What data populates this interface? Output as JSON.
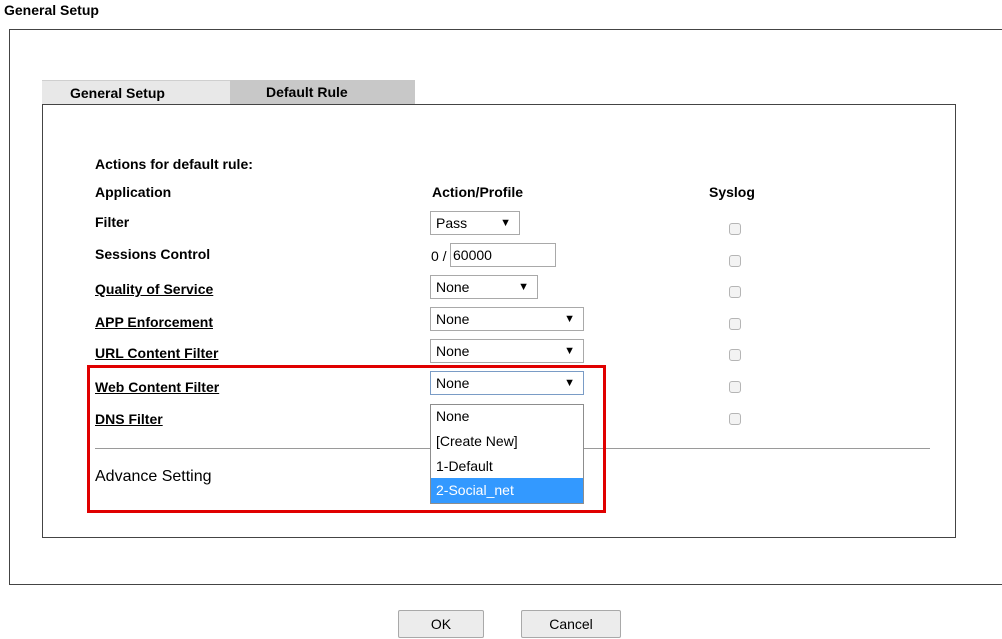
{
  "page": {
    "title": "General Setup"
  },
  "tabs": [
    {
      "label": "General Setup"
    },
    {
      "label": "Default Rule"
    }
  ],
  "section": {
    "heading": "Actions for default rule:",
    "columns": {
      "application": "Application",
      "action": "Action/Profile",
      "syslog": "Syslog"
    }
  },
  "rows": [
    {
      "label": "Filter",
      "value": "Pass",
      "underlined": false
    },
    {
      "label": "Sessions Control",
      "sessions_current": "0 /",
      "sessions_max": "60000",
      "underlined": false
    },
    {
      "label": "Quality of Service",
      "value": "None",
      "underlined": true
    },
    {
      "label": "APP Enforcement",
      "value": "None",
      "underlined": true
    },
    {
      "label": "URL Content Filter",
      "value": "None",
      "underlined": true
    },
    {
      "label": "Web Content Filter",
      "value": "None",
      "underlined": true
    },
    {
      "label": "DNS Filter",
      "underlined": true
    }
  ],
  "dropdown": {
    "options": [
      "None",
      "[Create New]",
      "1-Default",
      "2-Social_net"
    ],
    "highlighted_index": 3,
    "highlight_color": "#3399ff"
  },
  "advance": {
    "label": "Advance Setting"
  },
  "buttons": {
    "ok": "OK",
    "cancel": "Cancel"
  },
  "colors": {
    "highlight_box": "#e00000"
  }
}
